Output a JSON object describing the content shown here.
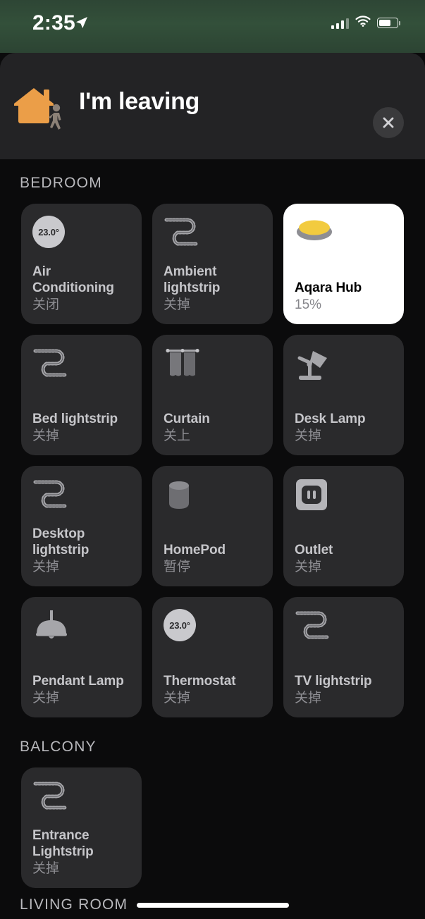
{
  "status_bar": {
    "time": "2:35",
    "location_icon": "location-arrow-icon",
    "signal_icon": "cellular-signal-icon",
    "signal_bars_filled": 2,
    "signal_bars_total": 4,
    "wifi_icon": "wifi-icon",
    "battery_icon": "battery-icon",
    "battery_level_percent": 58
  },
  "header": {
    "title": "I'm leaving",
    "scene_icon": "house-person-leaving-icon",
    "close_label": "✕",
    "close_icon": "close-icon",
    "house_color": "#eb9e48",
    "person_color": "#8c8177"
  },
  "colors": {
    "page_background": "#0b0b0c",
    "card_background": "#232325",
    "tile_background": "#2a2a2c",
    "tile_active_background": "#ffffff",
    "accent_orange": "#eb9e48",
    "accent_yellow": "#f2cb3f",
    "text_primary": "#c6c6ca",
    "text_secondary": "#8e8e93",
    "status_bar_green": "#2e4635"
  },
  "sections": [
    {
      "name": "BEDROOM",
      "tiles": [
        {
          "name": "Air Conditioning",
          "state": "关闭",
          "icon": "thermostat-dial-icon",
          "temperature": "23.0°",
          "active": false
        },
        {
          "name": "Ambient lightstrip",
          "state": "关掉",
          "icon": "lightstrip-icon",
          "active": false
        },
        {
          "name": "Aqara Hub",
          "state": "15%",
          "icon": "hub-light-puck-icon",
          "active": true
        }
      ]
    },
    {
      "name": "BEDROOM_ROW2",
      "hidden_title": true,
      "tiles": [
        {
          "name": "Bed lightstrip",
          "state": "关掉",
          "icon": "lightstrip-icon",
          "active": false
        },
        {
          "name": "Curtain",
          "state": "关上",
          "icon": "curtain-icon",
          "active": false
        },
        {
          "name": "Desk Lamp",
          "state": "关掉",
          "icon": "desk-lamp-icon",
          "active": false
        }
      ]
    },
    {
      "name": "BEDROOM_ROW3",
      "hidden_title": true,
      "tiles": [
        {
          "name": "Desktop lightstrip",
          "state": "关掉",
          "icon": "lightstrip-icon",
          "active": false
        },
        {
          "name": "HomePod",
          "state": "暂停",
          "icon": "homepod-icon",
          "active": false
        },
        {
          "name": "Outlet",
          "state": "关掉",
          "icon": "outlet-icon",
          "active": false
        }
      ]
    },
    {
      "name": "BEDROOM_ROW4",
      "hidden_title": true,
      "tiles": [
        {
          "name": "Pendant Lamp",
          "state": "关掉",
          "icon": "pendant-lamp-icon",
          "active": false
        },
        {
          "name": "Thermostat",
          "state": "关掉",
          "icon": "thermostat-dial-icon",
          "temperature": "23.0°",
          "active": false
        },
        {
          "name": "TV lightstrip",
          "state": "关掉",
          "icon": "lightstrip-icon",
          "active": false
        }
      ]
    },
    {
      "name": "BALCONY",
      "tiles": [
        {
          "name": "Entrance Lightstrip",
          "state": "关掉",
          "icon": "lightstrip-icon",
          "active": false
        }
      ]
    }
  ],
  "bottom": {
    "next_section_label": "LIVING ROOM",
    "home_indicator": "home-indicator"
  }
}
